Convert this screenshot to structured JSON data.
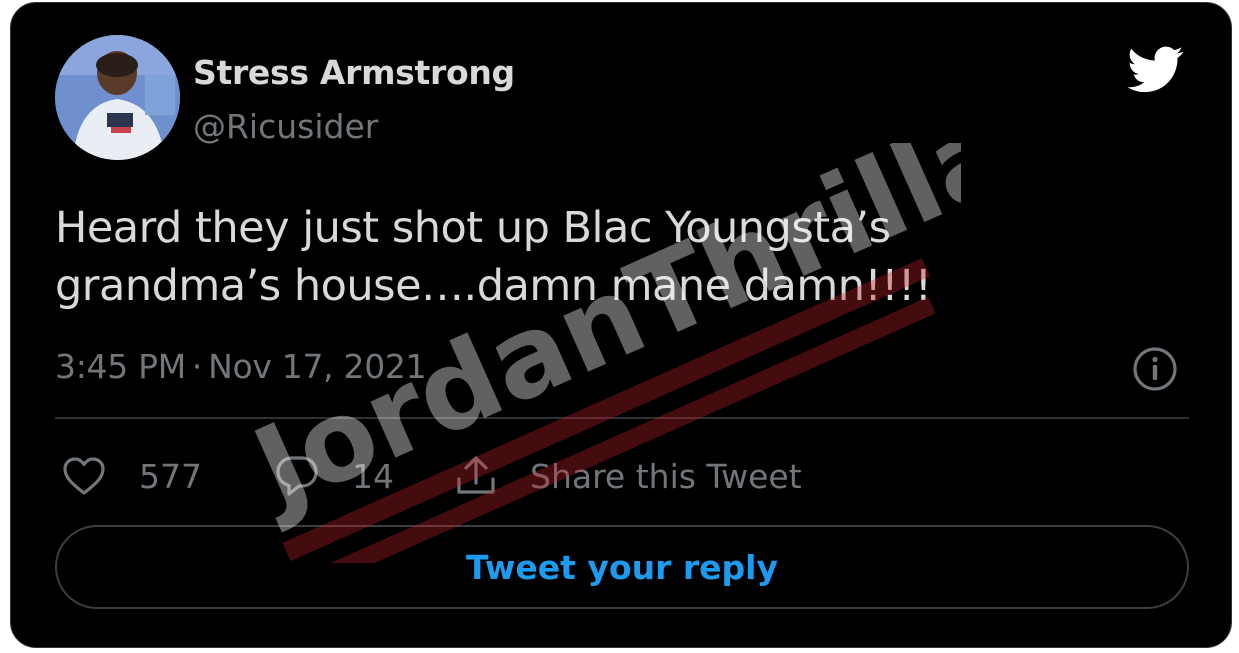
{
  "tweet": {
    "display_name": "Stress Armstrong",
    "handle": "@Ricusider",
    "text_line1": "Heard they just shot up Blac Youngsta’s",
    "text_line2": "grandma’s house….damn mane damn!!!!",
    "time": "3:45 PM",
    "separator": "·",
    "date": "Nov 17, 2021"
  },
  "actions": {
    "like_count": "577",
    "reply_count": "14",
    "share_label": "Share this Tweet"
  },
  "reply_button": {
    "label": "Tweet your reply"
  },
  "watermark": {
    "text": "JordanThrilla."
  },
  "icons": {
    "brand": "twitter-bird-icon",
    "info": "info-icon",
    "like": "heart-icon",
    "reply": "reply-bubble-icon",
    "share": "share-upload-icon"
  },
  "colors": {
    "background": "#000000",
    "text": "#d9d9d9",
    "muted": "#71767b",
    "accent": "#1d9bf0",
    "watermark_bar": "#c8232c"
  }
}
